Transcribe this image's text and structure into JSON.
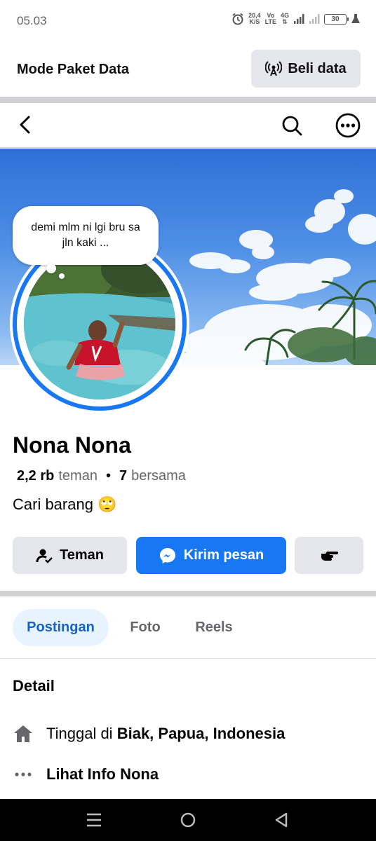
{
  "status_bar": {
    "time": "05.03",
    "speed_value": "20,4",
    "speed_unit": "K/S",
    "vo": "Vo",
    "lte": "LTE",
    "network": "4G",
    "battery": "30",
    "icons": [
      "alarm-icon",
      "signal-icon",
      "battery-icon",
      "flask-icon"
    ]
  },
  "data_bar": {
    "title": "Mode Paket Data",
    "buy_label": "Beli data"
  },
  "profile": {
    "note": "demi mlm ni lgi bru sa jln kaki ...",
    "name": "Nona Nona",
    "friends_count": "2,2 rb",
    "friends_label": "teman",
    "mutual_count": "7",
    "mutual_label": "bersama",
    "bio": "Cari barang 🙄"
  },
  "actions": {
    "friends_label": "Teman",
    "message_label": "Kirim pesan"
  },
  "tabs": [
    {
      "label": "Postingan",
      "active": true
    },
    {
      "label": "Foto",
      "active": false
    },
    {
      "label": "Reels",
      "active": false
    }
  ],
  "details": {
    "title": "Detail",
    "lives_prefix": "Tinggal di",
    "lives_place": "Biak, Papua, Indonesia",
    "info_label": "Lihat Info Nona"
  },
  "colors": {
    "accent": "#1877f2",
    "button_gray": "#e4e6eb",
    "tab_active_bg": "#e7f3ff"
  }
}
